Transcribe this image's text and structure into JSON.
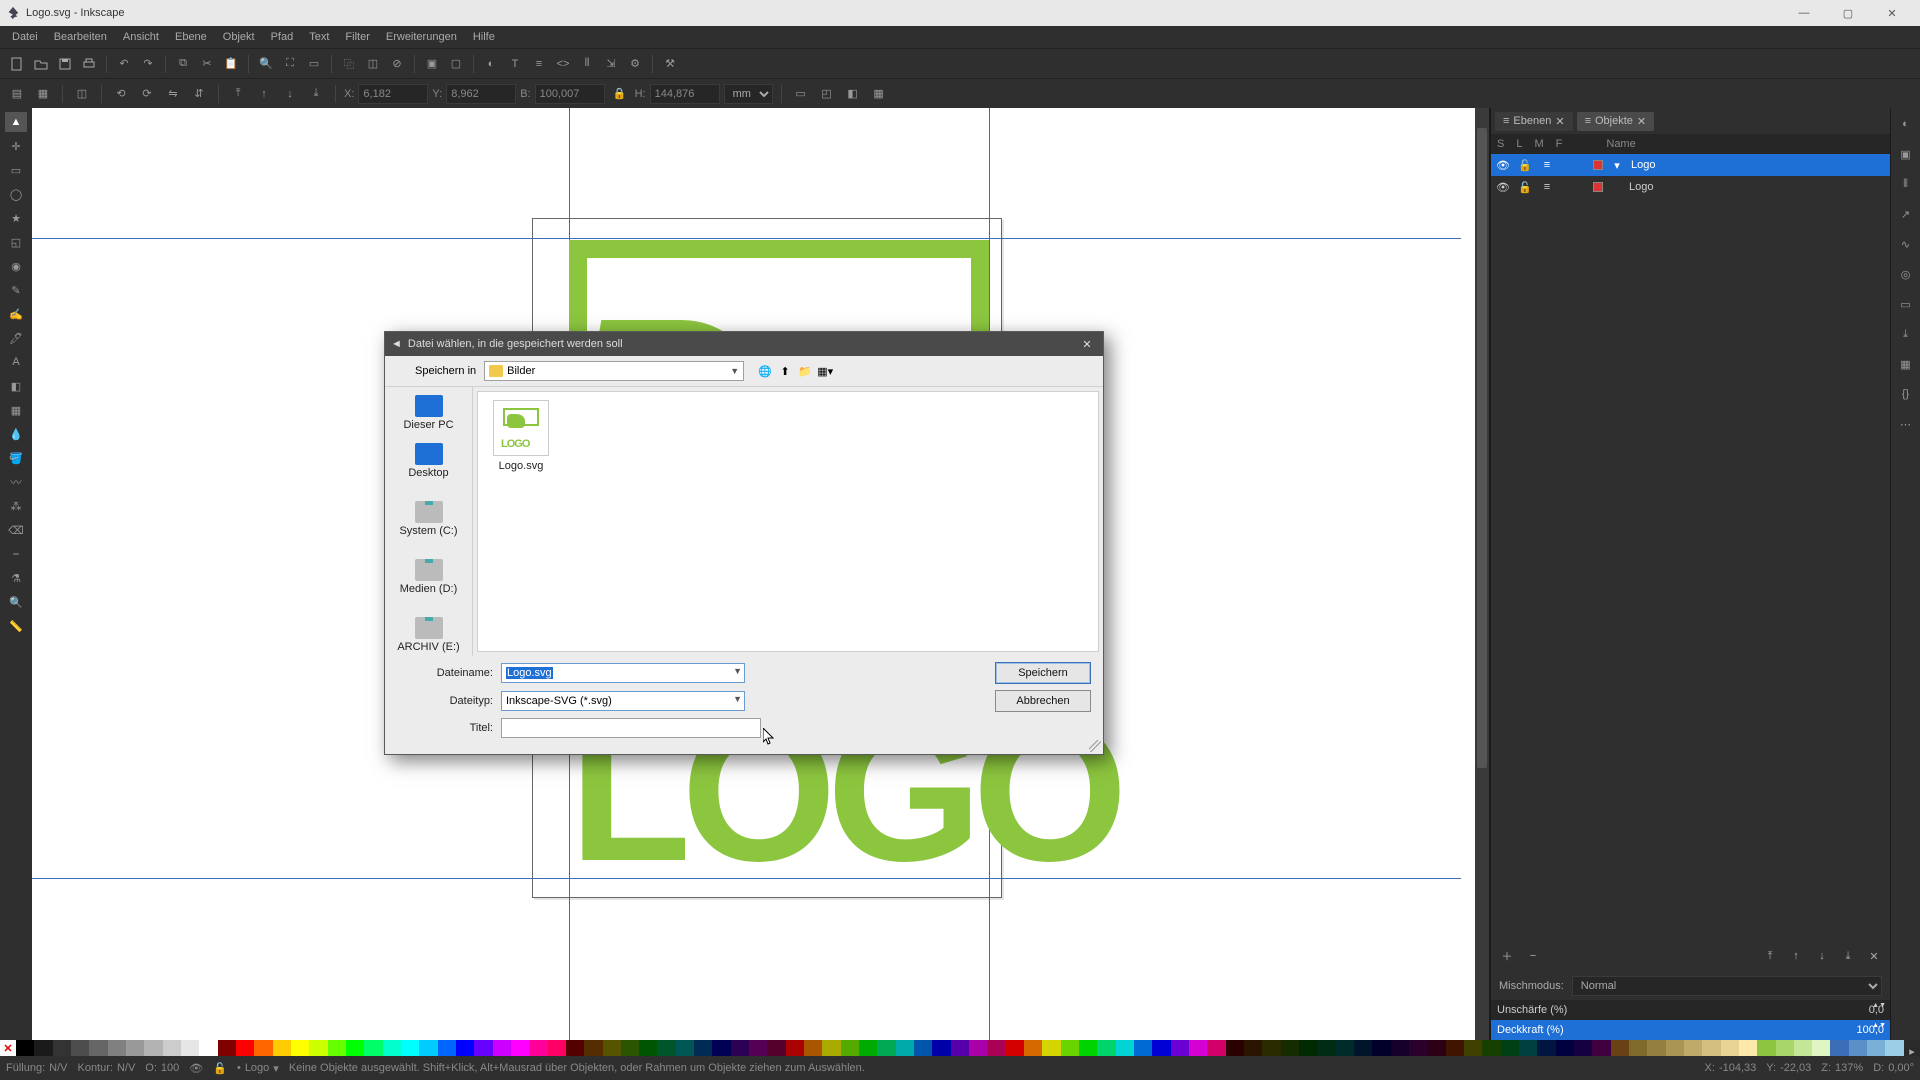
{
  "window": {
    "title": "Logo.svg - Inkscape"
  },
  "menu": {
    "items": [
      "Datei",
      "Bearbeiten",
      "Ansicht",
      "Ebene",
      "Objekt",
      "Pfad",
      "Text",
      "Filter",
      "Erweiterungen",
      "Hilfe"
    ]
  },
  "tooloptions": {
    "x_label": "X:",
    "x": "6,182",
    "y_label": "Y:",
    "y": "8,962",
    "w_label": "B:",
    "w": "100,007",
    "h_label": "H:",
    "h": "144,876",
    "unit": "mm"
  },
  "panels": {
    "tab_layers": "Ebenen",
    "tab_objects": "Objekte",
    "head": {
      "s": "S",
      "l": "L",
      "m": "M",
      "f": "F",
      "name": "Name"
    },
    "rows": [
      {
        "name": "Logo",
        "selected": true,
        "expandable": true
      },
      {
        "name": "Logo",
        "selected": false,
        "expandable": false
      }
    ],
    "blend_label": "Mischmodus:",
    "blend_value": "Normal",
    "blur_label": "Unschärfe (%)",
    "blur_value": "0,0",
    "opacity_label": "Deckkraft (%)",
    "opacity_value": "100,0"
  },
  "dialog": {
    "title": "Datei wählen, in die gespeichert werden soll",
    "savein_label": "Speichern in",
    "folder": "Bilder",
    "places": [
      "Dieser PC",
      "Desktop",
      "System (C:)",
      "Medien (D:)",
      "ARCHIV (E:)"
    ],
    "file_item": "Logo.svg",
    "filename_label": "Dateiname:",
    "filename": "Logo.svg",
    "filetype_label": "Dateityp:",
    "filetype": "Inkscape-SVG (*.svg)",
    "title_label": "Titel:",
    "title_value": "",
    "save": "Speichern",
    "cancel": "Abbrechen"
  },
  "status": {
    "fill": "Füllung:",
    "stroke": "Kontur:",
    "fill_val": "N/V",
    "stroke_val": "N/V",
    "opacity_label": "O:",
    "opacity": "100",
    "layer": "Logo",
    "hint": "Keine Objekte ausgewählt. Shift+Klick, Alt+Mausrad über Objekten, oder Rahmen um Objekte ziehen zum Auswählen.",
    "coord_x_label": "X:",
    "coord_x": "-104,33",
    "coord_y_label": "Y:",
    "coord_y": "-22,03",
    "zoom_label": "Z:",
    "zoom": "137%",
    "rot_label": "D:",
    "rot": "0,00°"
  },
  "palette_colors": [
    "#000000",
    "#1a1a1a",
    "#333333",
    "#4d4d4d",
    "#666666",
    "#808080",
    "#999999",
    "#b3b3b3",
    "#cccccc",
    "#e6e6e6",
    "#ffffff",
    "#800000",
    "#ff0000",
    "#ff6600",
    "#ffcc00",
    "#ffff00",
    "#ccff00",
    "#66ff00",
    "#00ff00",
    "#00ff66",
    "#00ffcc",
    "#00ffff",
    "#00ccff",
    "#0066ff",
    "#0000ff",
    "#6600ff",
    "#cc00ff",
    "#ff00ff",
    "#ff0099",
    "#ff0066",
    "#550000",
    "#552b00",
    "#555500",
    "#2b5500",
    "#005500",
    "#00552b",
    "#005555",
    "#002b55",
    "#000055",
    "#2b0055",
    "#550055",
    "#55002b",
    "#aa0000",
    "#aa5500",
    "#aaaa00",
    "#55aa00",
    "#00aa00",
    "#00aa55",
    "#00aaaa",
    "#0055aa",
    "#0000aa",
    "#5500aa",
    "#aa00aa",
    "#aa0055",
    "#d40000",
    "#d46a00",
    "#d4d400",
    "#6ad400",
    "#00d400",
    "#00d46a",
    "#00d4d4",
    "#006ad4",
    "#0000d4",
    "#6a00d4",
    "#d400d4",
    "#d4006a",
    "#2b0000",
    "#2b1500",
    "#2b2b00",
    "#152b00",
    "#002b00",
    "#002b15",
    "#002b2b",
    "#00152b",
    "#00002b",
    "#15002b",
    "#2b002b",
    "#2b0015",
    "#401500",
    "#404000",
    "#154000",
    "#004015",
    "#004040",
    "#001540",
    "#000040",
    "#150040",
    "#400040",
    "#6a4015",
    "#806a2b",
    "#957f40",
    "#aa9555",
    "#bfaa6a",
    "#d4bf80",
    "#e9d495",
    "#ffe9aa",
    "#8cc63f",
    "#a8d66b",
    "#c3e697",
    "#dff6c3",
    "#3a6fb7",
    "#5a8fc7",
    "#7aafd7",
    "#9acfe7"
  ]
}
